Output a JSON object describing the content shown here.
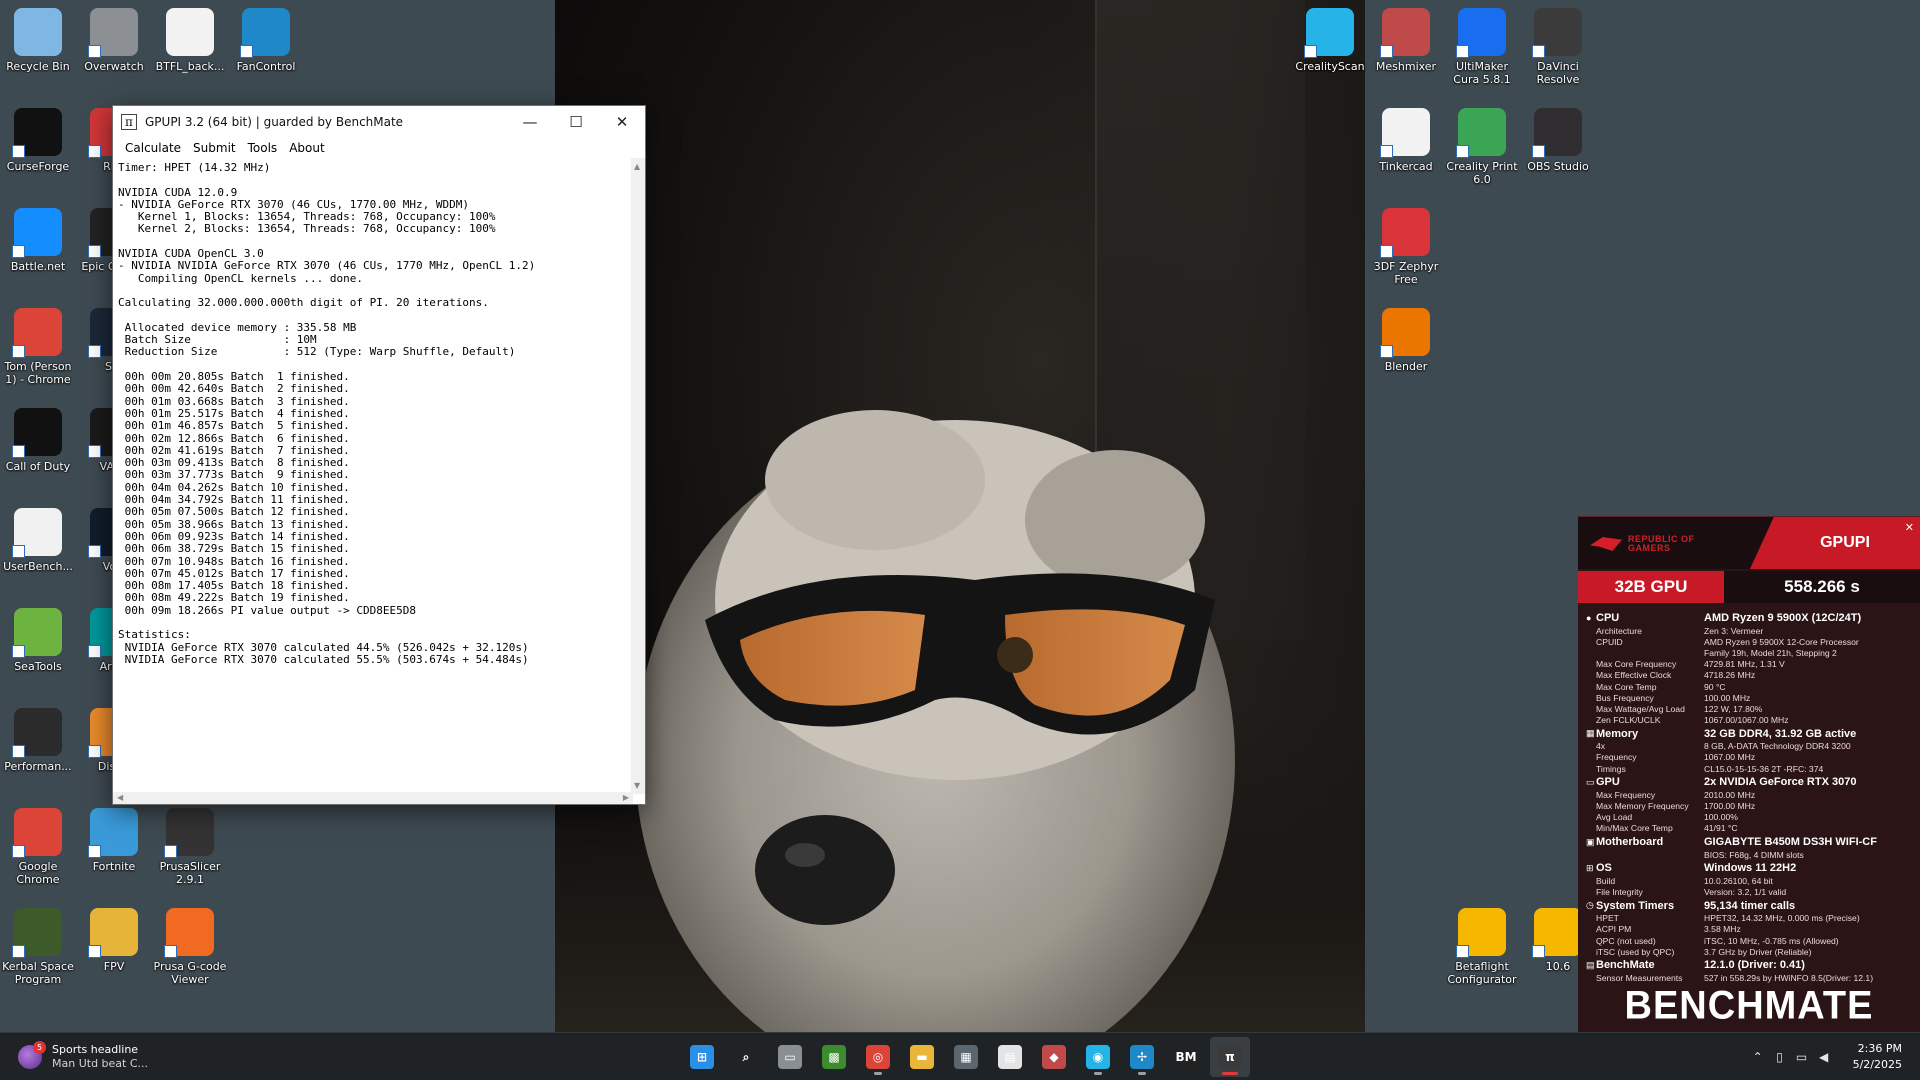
{
  "desktop_icons": [
    {
      "id": "recycle",
      "label": "Recycle Bin",
      "icon": "recycle-bin-icon",
      "color": "#7fb6e4"
    },
    {
      "id": "overwatch",
      "label": "Overwatch",
      "icon": "overwatch-icon",
      "color": "#8c8f93"
    },
    {
      "id": "btfl",
      "label": "BTFL_back...",
      "icon": "document-icon",
      "color": "#f2f2f2"
    },
    {
      "id": "fancontrol",
      "label": "FanControl",
      "icon": "fan-icon",
      "color": "#1e88c8"
    },
    {
      "id": "curseforge",
      "label": "CurseForge",
      "icon": "curseforge-icon",
      "color": "#111111"
    },
    {
      "id": "riot",
      "label": "Riot",
      "icon": "riot-icon",
      "color": "#d13639"
    },
    {
      "id": "battlenet",
      "label": "Battle.net",
      "icon": "battlenet-icon",
      "color": "#148eff"
    },
    {
      "id": "epic",
      "label": "Epic G Laun",
      "icon": "epic-games-icon",
      "color": "#222222"
    },
    {
      "id": "chrome-tom",
      "label": "Tom (Person 1) - Chrome",
      "icon": "chrome-icon",
      "color": "#db4437"
    },
    {
      "id": "steam",
      "label": "Ste",
      "icon": "steam-icon",
      "color": "#1b2838"
    },
    {
      "id": "cod",
      "label": "Call of Duty",
      "icon": "call-of-duty-icon",
      "color": "#111111"
    },
    {
      "id": "valorant",
      "label": "VALO",
      "icon": "valorant-icon",
      "color": "#1a1a1a"
    },
    {
      "id": "userbench",
      "label": "UserBench...",
      "icon": "gauge-icon",
      "color": "#f1f1f1"
    },
    {
      "id": "voice",
      "label": "Voic",
      "icon": "voicemod-icon",
      "color": "#0f1d2a"
    },
    {
      "id": "seatools",
      "label": "SeaTools",
      "icon": "seatools-icon",
      "color": "#6cb33f"
    },
    {
      "id": "arduino",
      "label": "Ardui",
      "icon": "arduino-icon",
      "color": "#00979c"
    },
    {
      "id": "performance",
      "label": "Performan...",
      "icon": "performance-icon",
      "color": "#2b2b2b"
    },
    {
      "id": "disk",
      "label": "DiskG",
      "icon": "disk-icon",
      "color": "#e98a2b"
    },
    {
      "id": "gchrome",
      "label": "Google Chrome",
      "icon": "chrome-icon",
      "color": "#db4437"
    },
    {
      "id": "fortnite",
      "label": "Fortnite",
      "icon": "fortnite-icon",
      "color": "#3a9ad9"
    },
    {
      "id": "prusaslicer",
      "label": "PrusaSlicer 2.9.1",
      "icon": "prusaslicer-icon",
      "color": "#333333"
    },
    {
      "id": "ksp",
      "label": "Kerbal Space Program",
      "icon": "kerbal-icon",
      "color": "#3c5a2a"
    },
    {
      "id": "fpv",
      "label": "FPV",
      "icon": "folder-icon",
      "color": "#e7b43a"
    },
    {
      "id": "prusagcode",
      "label": "Prusa G-code Viewer",
      "icon": "gcode-viewer-icon",
      "color": "#f06a22"
    },
    {
      "id": "crealityscan",
      "label": "CrealityScan",
      "icon": "crealityscan-icon",
      "color": "#25b3e8"
    },
    {
      "id": "meshmixer",
      "label": "Meshmixer",
      "icon": "meshmixer-icon",
      "color": "#c04a4a"
    },
    {
      "id": "cura",
      "label": "UltiMaker Cura 5.8.1",
      "icon": "cura-icon",
      "color": "#196ef0"
    },
    {
      "id": "davinci",
      "label": "DaVinci Resolve",
      "icon": "davinci-icon",
      "color": "#3b3b3b"
    },
    {
      "id": "tinkercad",
      "label": "Tinkercad",
      "icon": "tinkercad-icon",
      "color": "#f2f2f2"
    },
    {
      "id": "crealityprint",
      "label": "Creality Print 6.0",
      "icon": "creality-print-icon",
      "color": "#3aa655"
    },
    {
      "id": "obs",
      "label": "OBS Studio",
      "icon": "obs-icon",
      "color": "#302e31"
    },
    {
      "id": "zephyr",
      "label": "3DF Zephyr Free",
      "icon": "zephyr-icon",
      "color": "#d9343a"
    },
    {
      "id": "blender",
      "label": "Blender",
      "icon": "blender-icon",
      "color": "#ea7600"
    },
    {
      "id": "betaflight",
      "label": "Betaflight Configurator",
      "icon": "betaflight-icon",
      "color": "#f6b700"
    },
    {
      "id": "bf106",
      "label": "10.6",
      "icon": "betaflight-icon",
      "color": "#f6b700"
    }
  ],
  "gpupi_window": {
    "title": "GPUPI 3.2 (64 bit) | guarded by BenchMate",
    "menu": [
      "Calculate",
      "Submit",
      "Tools",
      "About"
    ],
    "console_lines": [
      "Timer: HPET (14.32 MHz)",
      "",
      "NVIDIA CUDA 12.0.9",
      "- NVIDIA GeForce RTX 3070 (46 CUs, 1770.00 MHz, WDDM)",
      "   Kernel 1, Blocks: 13654, Threads: 768, Occupancy: 100%",
      "   Kernel 2, Blocks: 13654, Threads: 768, Occupancy: 100%",
      "",
      "NVIDIA CUDA OpenCL 3.0",
      "- NVIDIA NVIDIA GeForce RTX 3070 (46 CUs, 1770 MHz, OpenCL 1.2)",
      "   Compiling OpenCL kernels ... done.",
      "",
      "Calculating 32.000.000.000th digit of PI. 20 iterations.",
      "",
      " Allocated device memory : 335.58 MB",
      " Batch Size              : 10M",
      " Reduction Size          : 512 (Type: Warp Shuffle, Default)",
      "",
      " 00h 00m 20.805s Batch  1 finished.",
      " 00h 00m 42.640s Batch  2 finished.",
      " 00h 01m 03.668s Batch  3 finished.",
      " 00h 01m 25.517s Batch  4 finished.",
      " 00h 01m 46.857s Batch  5 finished.",
      " 00h 02m 12.866s Batch  6 finished.",
      " 00h 02m 41.619s Batch  7 finished.",
      " 00h 03m 09.413s Batch  8 finished.",
      " 00h 03m 37.773s Batch  9 finished.",
      " 00h 04m 04.262s Batch 10 finished.",
      " 00h 04m 34.792s Batch 11 finished.",
      " 00h 05m 07.500s Batch 12 finished.",
      " 00h 05m 38.966s Batch 13 finished.",
      " 00h 06m 09.923s Batch 14 finished.",
      " 00h 06m 38.729s Batch 15 finished.",
      " 00h 07m 10.948s Batch 16 finished.",
      " 00h 07m 45.012s Batch 17 finished.",
      " 00h 08m 17.405s Batch 18 finished.",
      " 00h 08m 49.222s Batch 19 finished.",
      " 00h 09m 18.266s PI value output -> CDD8EE5D8",
      "",
      "Statistics:",
      " NVIDIA GeForce RTX 3070 calculated 44.5% (526.042s + 32.120s)",
      " NVIDIA GeForce RTX 3070 calculated 55.5% (503.674s + 54.484s)"
    ]
  },
  "benchmate": {
    "brand_line1": "REPUBLIC OF",
    "brand_line2": "GAMERS",
    "benchmark": "GPUPI",
    "variant": "32B GPU",
    "score": "558.266 s",
    "sections": [
      {
        "id": "cpu",
        "icon": "●",
        "name": "CPU",
        "value": "AMD Ryzen 9 5900X (12C/24T)",
        "rows": [
          [
            "Architecture",
            "Zen 3: Vermeer"
          ],
          [
            "CPUID",
            "AMD Ryzen 9 5900X 12-Core Processor"
          ],
          [
            "",
            "Family 19h, Model 21h, Stepping 2"
          ],
          [
            "Max Core Frequency",
            "4729.81 MHz, 1.31 V"
          ],
          [
            "Max Effective Clock",
            "4718.26 MHz"
          ],
          [
            "Max Core Temp",
            "90 °C"
          ],
          [
            "Bus Frequency",
            "100.00 MHz"
          ],
          [
            "Max Wattage/Avg Load",
            "122 W, 17.80%"
          ],
          [
            "Zen FCLK/UCLK",
            "1067.00/1067.00 MHz"
          ]
        ]
      },
      {
        "id": "memory",
        "icon": "▦",
        "name": "Memory",
        "value": "32 GB DDR4, 31.92 GB active",
        "rows": [
          [
            "4x",
            "8 GB, A-DATA Technology DDR4 3200"
          ],
          [
            "Frequency",
            "1067.00 MHz"
          ],
          [
            "Timings",
            "CL15.0-15-15-36 2T -RFC: 374"
          ]
        ]
      },
      {
        "id": "gpu",
        "icon": "▭",
        "name": "GPU",
        "value": "2x NVIDIA GeForce RTX 3070",
        "rows": [
          [
            "Max Frequency",
            "2010.00 MHz"
          ],
          [
            "Max Memory Frequency",
            "1700.00 MHz"
          ],
          [
            "Avg Load",
            "100.00%"
          ],
          [
            "Min/Max Core Temp",
            "41/91 °C"
          ]
        ]
      },
      {
        "id": "motherboard",
        "icon": "▣",
        "name": "Motherboard",
        "value": "GIGABYTE B450M DS3H WIFI-CF",
        "rows": [
          [
            "",
            "BIOS: F68g, 4 DIMM slots"
          ]
        ]
      },
      {
        "id": "os",
        "icon": "⊞",
        "name": "OS",
        "value": "Windows 11 22H2",
        "rows": [
          [
            "Build",
            "10.0.26100, 64 bit"
          ],
          [
            "File Integrity",
            "Version: 3.2, 1/1 valid"
          ]
        ]
      },
      {
        "id": "timers",
        "icon": "◷",
        "name": "System Timers",
        "value": "95,134 timer calls",
        "rows": [
          [
            "HPET",
            "HPET32, 14.32 MHz, 0.000 ms (Precise)"
          ],
          [
            "ACPI PM",
            "3.58 MHz"
          ],
          [
            "QPC (not used)",
            "iTSC, 10 MHz, -0.785 ms (Allowed)"
          ],
          [
            "iTSC (used by QPC)",
            "3.7 GHz by Driver (Reliable)"
          ]
        ]
      },
      {
        "id": "benchmate",
        "icon": "▤",
        "name": "BenchMate",
        "value": "12.1.0 (Driver: 0.41)",
        "rows": [
          [
            "Sensor Measurements",
            "527 in 558.29s by HWiNFO 8.5(Driver: 12.1)"
          ]
        ]
      }
    ],
    "logo": "BENCHMATE",
    "colors": {
      "accent": "#c81a26",
      "panel": "#2a1416"
    }
  },
  "taskbar": {
    "news_title": "Sports headline",
    "news_sub": "Man Utd beat C...",
    "news_badge": "5",
    "apps": [
      {
        "id": "start",
        "icon": "windows-start-icon",
        "glyph": "⊞",
        "color": "#2b8fe8",
        "running": false
      },
      {
        "id": "search",
        "icon": "search-icon",
        "glyph": "⌕",
        "color": "transparent",
        "running": false
      },
      {
        "id": "taskview",
        "icon": "task-view-icon",
        "glyph": "▭",
        "color": "#8a8f93",
        "running": false
      },
      {
        "id": "minecraft",
        "icon": "minecraft-icon",
        "glyph": "▩",
        "color": "#3d8b2f",
        "running": false
      },
      {
        "id": "chrome",
        "icon": "chrome-icon",
        "glyph": "◎",
        "color": "#db4437",
        "running": true
      },
      {
        "id": "explorer",
        "icon": "file-explorer-icon",
        "glyph": "▬",
        "color": "#e9b53a",
        "running": false
      },
      {
        "id": "calculator",
        "icon": "calculator-icon",
        "glyph": "▦",
        "color": "#5b6770",
        "running": false
      },
      {
        "id": "tinkercad",
        "icon": "tinkercad-icon",
        "glyph": "▤",
        "color": "#e4e4e4",
        "running": false
      },
      {
        "id": "meshmixer",
        "icon": "meshmixer-icon",
        "glyph": "◆",
        "color": "#c04a4a",
        "running": false
      },
      {
        "id": "crealityscan",
        "icon": "crealityscan-icon",
        "glyph": "◉",
        "color": "#25b3e8",
        "running": true
      },
      {
        "id": "fancontrol",
        "icon": "fan-icon",
        "glyph": "✢",
        "color": "#1e88c8",
        "running": true
      },
      {
        "id": "benchmate",
        "icon": "benchmate-icon",
        "glyph": "BM",
        "color": "#222222",
        "running": false
      },
      {
        "id": "gpupi",
        "icon": "gpupi-icon",
        "glyph": "π",
        "color": "#3a3a3a",
        "running": true,
        "active": true
      }
    ],
    "time": "2:36 PM",
    "date": "5/2/2025"
  }
}
